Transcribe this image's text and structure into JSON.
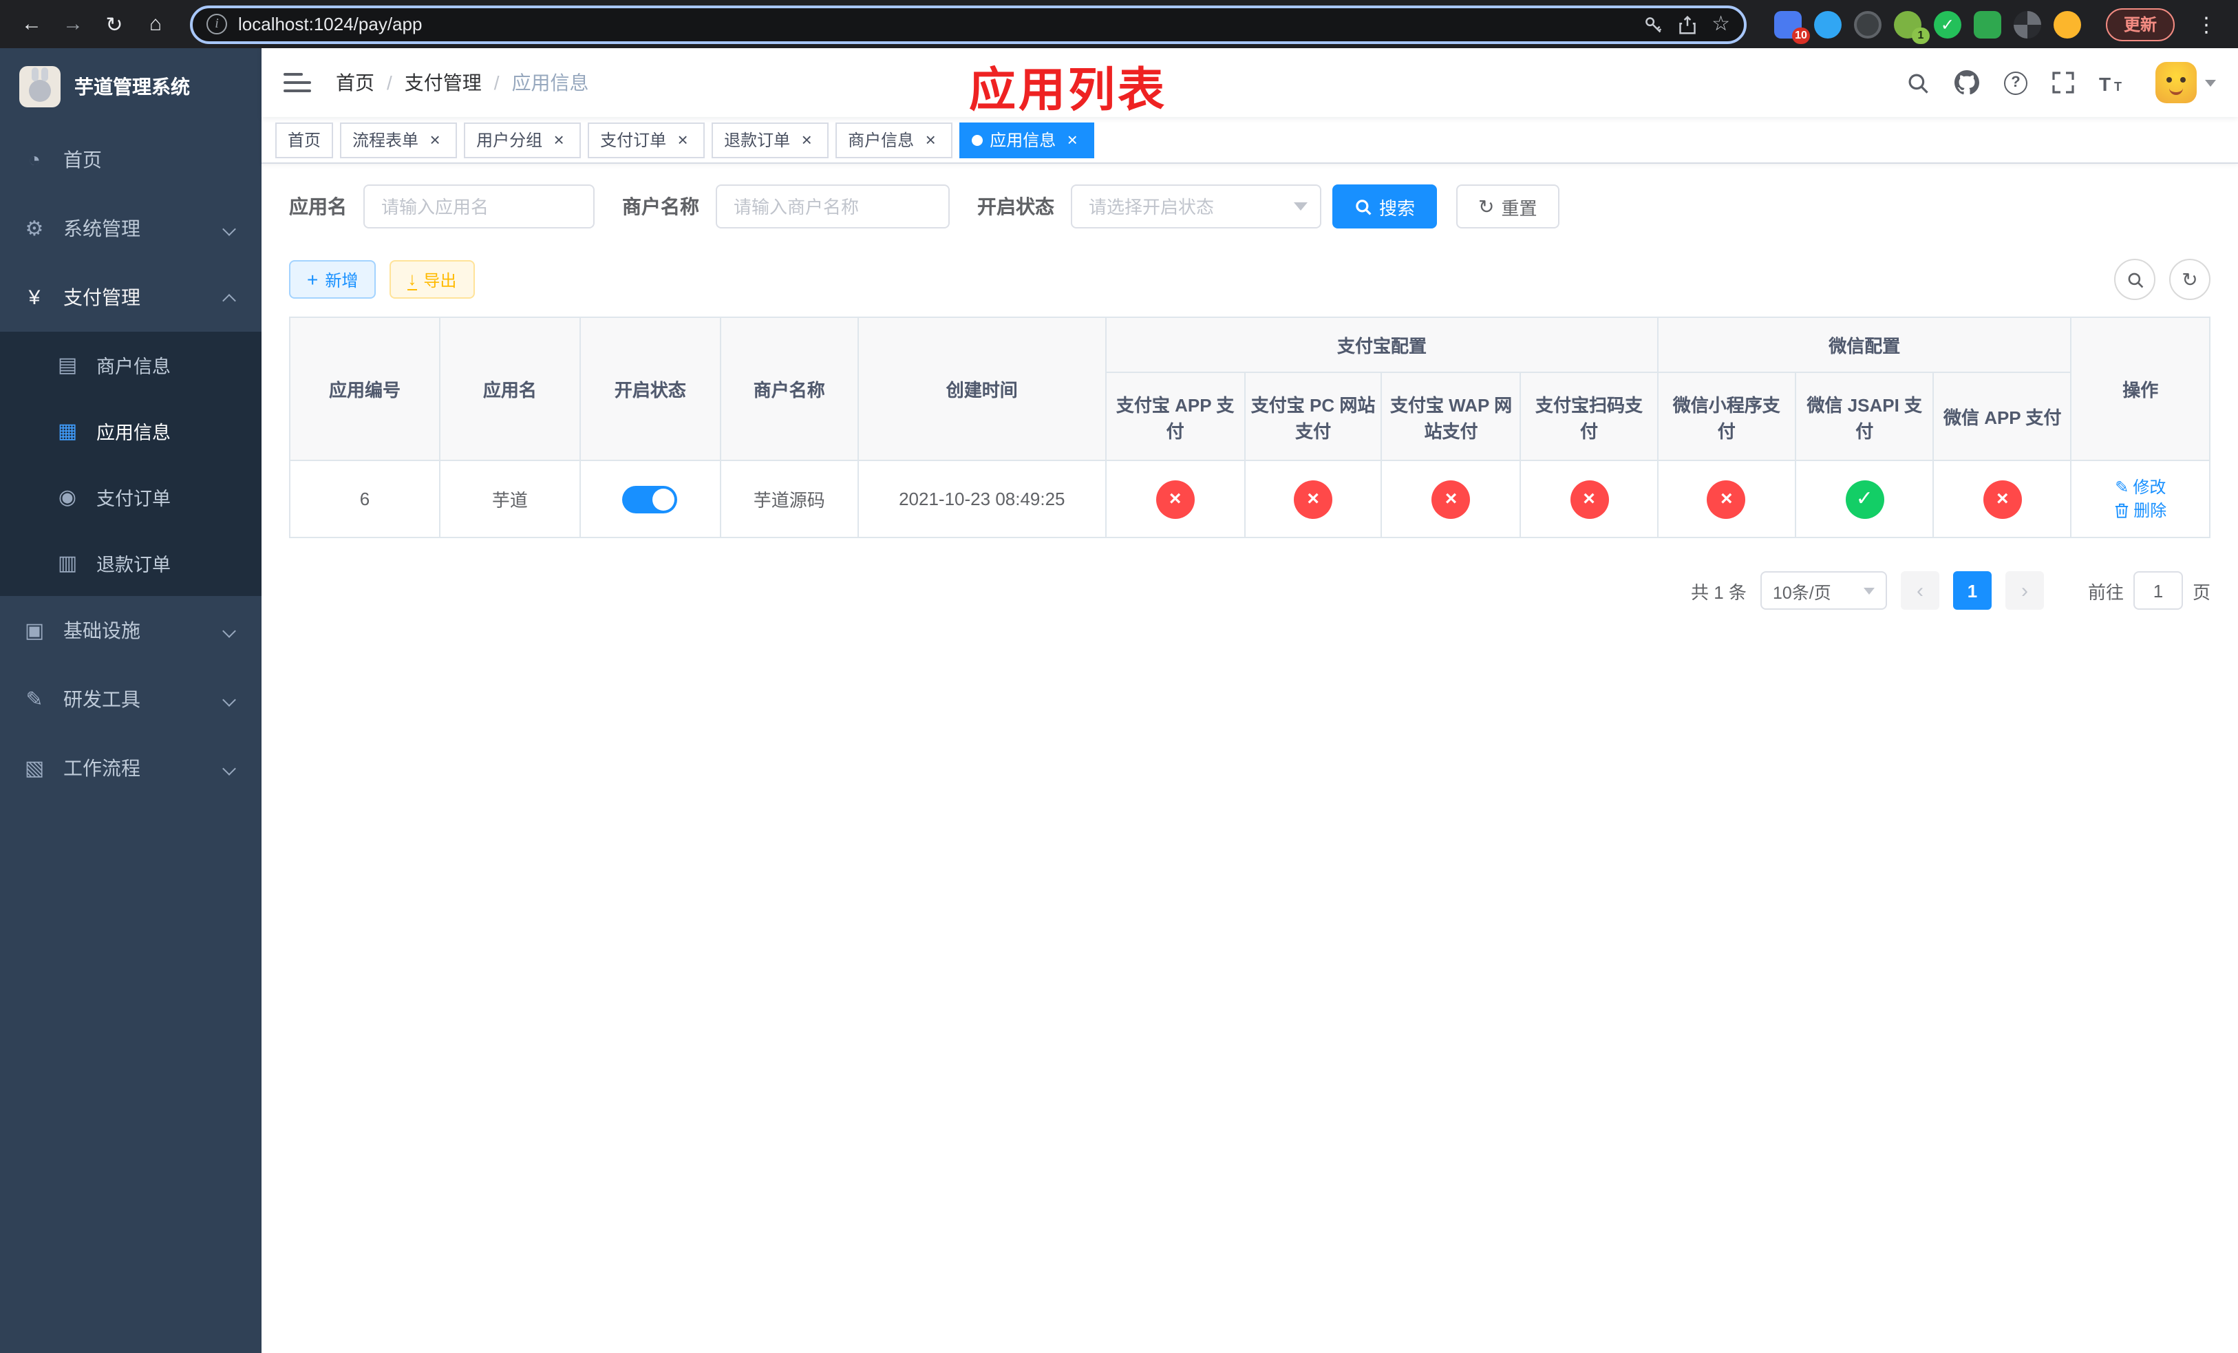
{
  "colors": {
    "accent": "#1890ff",
    "success": "#13ce66",
    "danger": "#ff4949",
    "sidebar_bg": "#304156",
    "annotation_red": "#ee2222"
  },
  "icons": {
    "back": "←",
    "forward": "→",
    "reload": "↻",
    "home": "⌂",
    "info": "i",
    "star": "☆",
    "menu_dots": "⋮",
    "dashboard": "◔",
    "gear": "⚙",
    "yen": "¥",
    "merchant": "▤",
    "app_grid": "▦",
    "pay_order": "◉",
    "refund": "▥",
    "infra": "▣",
    "devtools": "✎",
    "workflow": "▧",
    "help": "?",
    "plus": "+",
    "download": "↓",
    "refresh": "↻",
    "edit": "✎",
    "prev": "‹",
    "next": "›",
    "close": "×",
    "check": "✓",
    "cross": "×"
  },
  "browser": {
    "url": "localhost:1024/pay/app",
    "update_label": "更新",
    "extensions": [
      {
        "badge": "10"
      },
      {
        "badge": ""
      },
      {
        "badge": ""
      },
      {
        "badge": "1"
      },
      {
        "badge": ""
      },
      {
        "badge": ""
      },
      {
        "badge": ""
      },
      {
        "badge": ""
      }
    ]
  },
  "sidebar": {
    "title": "芋道管理系统",
    "items": [
      {
        "label": "首页"
      },
      {
        "label": "系统管理"
      },
      {
        "label": "支付管理"
      },
      {
        "label": "商户信息"
      },
      {
        "label": "应用信息"
      },
      {
        "label": "支付订单"
      },
      {
        "label": "退款订单"
      },
      {
        "label": "基础设施"
      },
      {
        "label": "研发工具"
      },
      {
        "label": "工作流程"
      }
    ]
  },
  "navbar": {
    "breadcrumb": {
      "home": "首页",
      "section": "支付管理",
      "current": "应用信息"
    },
    "overlay_title": "应用列表"
  },
  "tabs": [
    {
      "label": "首页"
    },
    {
      "label": "流程表单"
    },
    {
      "label": "用户分组"
    },
    {
      "label": "支付订单"
    },
    {
      "label": "退款订单"
    },
    {
      "label": "商户信息"
    },
    {
      "label": "应用信息"
    }
  ],
  "filters": {
    "app_name_label": "应用名",
    "app_name_placeholder": "请输入应用名",
    "merchant_label": "商户名称",
    "merchant_placeholder": "请输入商户名称",
    "status_label": "开启状态",
    "status_placeholder": "请选择开启状态",
    "search_label": "搜索",
    "reset_label": "重置"
  },
  "toolbar": {
    "add_label": "新增",
    "export_label": "导出"
  },
  "table": {
    "columns": {
      "id": "应用编号",
      "name": "应用名",
      "status": "开启状态",
      "merchant": "商户名称",
      "created": "创建时间",
      "alipay_group": "支付宝配置",
      "wechat_group": "微信配置",
      "alipay_app": "支付宝 APP 支付",
      "alipay_pc": "支付宝 PC 网站支付",
      "alipay_wap": "支付宝 WAP 网站支付",
      "alipay_qr": "支付宝扫码支付",
      "wx_mini": "微信小程序支付",
      "wx_jsapi": "微信 JSAPI 支付",
      "wx_app": "微信 APP 支付",
      "ops": "操作"
    },
    "rows": [
      {
        "id": "6",
        "name": "芋道",
        "enabled": true,
        "merchant": "芋道源码",
        "created_at": "2021-10-23 08:49:25",
        "alipay_app": false,
        "alipay_pc": false,
        "alipay_wap": false,
        "alipay_qr": false,
        "wx_mini": false,
        "wx_jsapi": true,
        "wx_app": false,
        "edit_label": "修改",
        "delete_label": "删除"
      }
    ]
  },
  "pagination": {
    "total_text": "共 1 条",
    "page_size": "10条/页",
    "current_page": "1",
    "goto_prefix": "前往",
    "goto_value": "1",
    "goto_suffix": "页"
  }
}
